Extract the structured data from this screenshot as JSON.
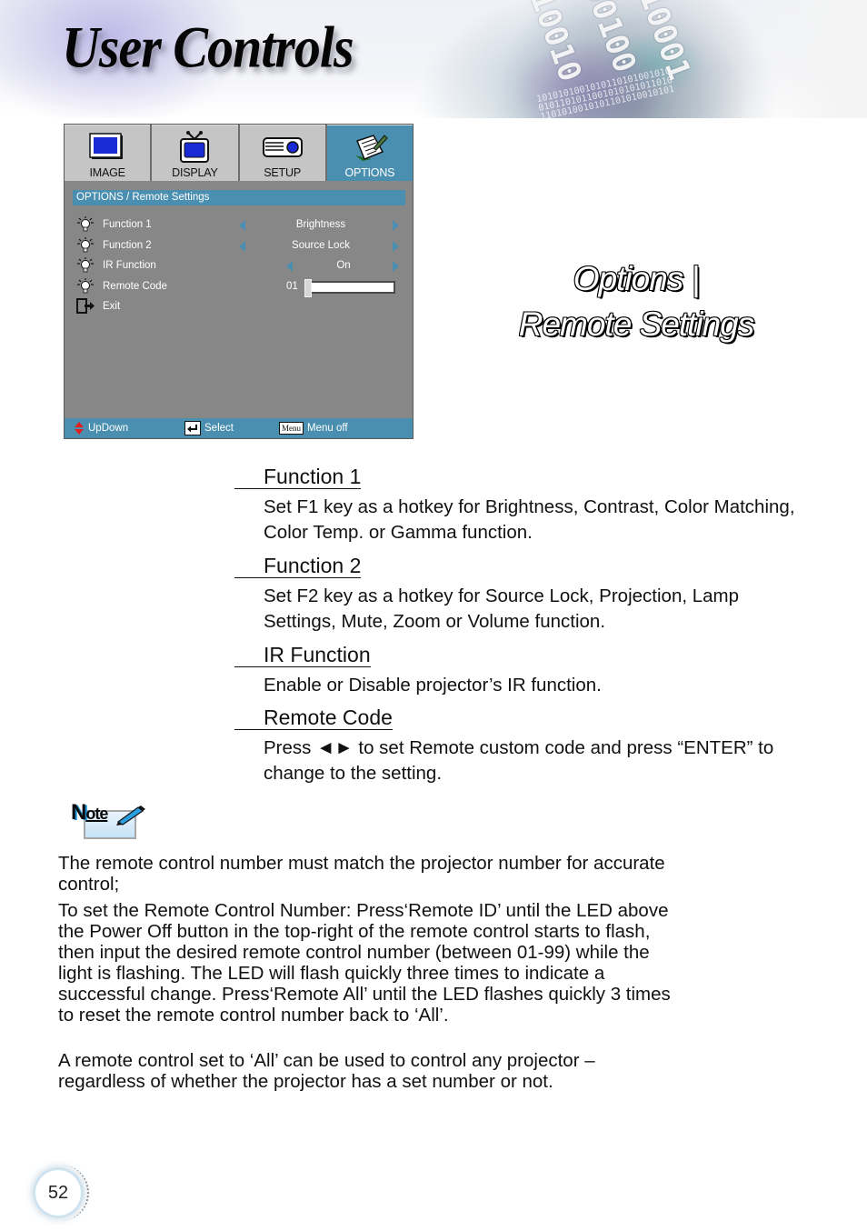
{
  "header": {
    "title": "User Controls"
  },
  "osd_menu": {
    "tabs": [
      {
        "label": "IMAGE",
        "icon": "image-icon",
        "active": false
      },
      {
        "label": "DISPLAY",
        "icon": "display-tv-icon",
        "active": false
      },
      {
        "label": "SETUP",
        "icon": "setup-projector-icon",
        "active": false
      },
      {
        "label": "OPTIONS",
        "icon": "options-notepad-icon",
        "active": true
      }
    ],
    "breadcrumb": "OPTIONS / Remote Settings",
    "rows": [
      {
        "label": "Function 1",
        "icon": "lightbulb-icon",
        "value": "Brightness"
      },
      {
        "label": "Function 2",
        "icon": "lightbulb-icon",
        "value": "Source Lock"
      },
      {
        "label": "IR Function",
        "icon": "lightbulb-icon",
        "value": "On"
      },
      {
        "label": "Remote Code",
        "icon": "lightbulb-icon",
        "value": "01",
        "slider_fraction": 0.0
      },
      {
        "label": "Exit",
        "icon": "exit-icon"
      }
    ],
    "footer": {
      "updown": "UpDown",
      "select": "Select",
      "menu_key": "Menu",
      "menu_off": "Menu off"
    },
    "colors": {
      "accent": "#4b8fb0",
      "panel": "#878787",
      "tab_inactive": "#c5c5c5"
    }
  },
  "side_heading": {
    "line1": "Options |",
    "line2": "Remote Settings"
  },
  "sections": [
    {
      "title": "Function 1",
      "body": "Set F1 key as a hotkey for Brightness, Contrast, Color Matching, Color Temp. or Gamma function."
    },
    {
      "title": "Function 2",
      "body": "Set F2 key as a hotkey for Source Lock, Projection, Lamp Settings, Mute, Zoom or Volume function."
    },
    {
      "title": "IR Function",
      "body": "Enable or Disable projector’s IR function."
    },
    {
      "title": "Remote Code",
      "body": "Press ◄► to set Remote custom code and press “ENTER” to change to the setting."
    }
  ],
  "note": {
    "label_big": "N",
    "label_small": "ote",
    "paragraphs": [
      "The remote control number must match the projector number for accurate control;",
      "To set the Remote Control Number: Press‘Remote ID’ until the LED above the Power Off button in the top-right of the remote control starts to flash, then input the desired remote control number (between 01-99) while the light is flashing.  The LED will flash quickly three times to indicate a successful change. Press‘Remote All’ until the LED flashes quickly 3 times to reset the remote control number back to ‘All’.",
      "A remote control set to ‘All’ can be used to control any projector – regardless of whether the projector has a set number or not."
    ]
  },
  "page_number": "52"
}
